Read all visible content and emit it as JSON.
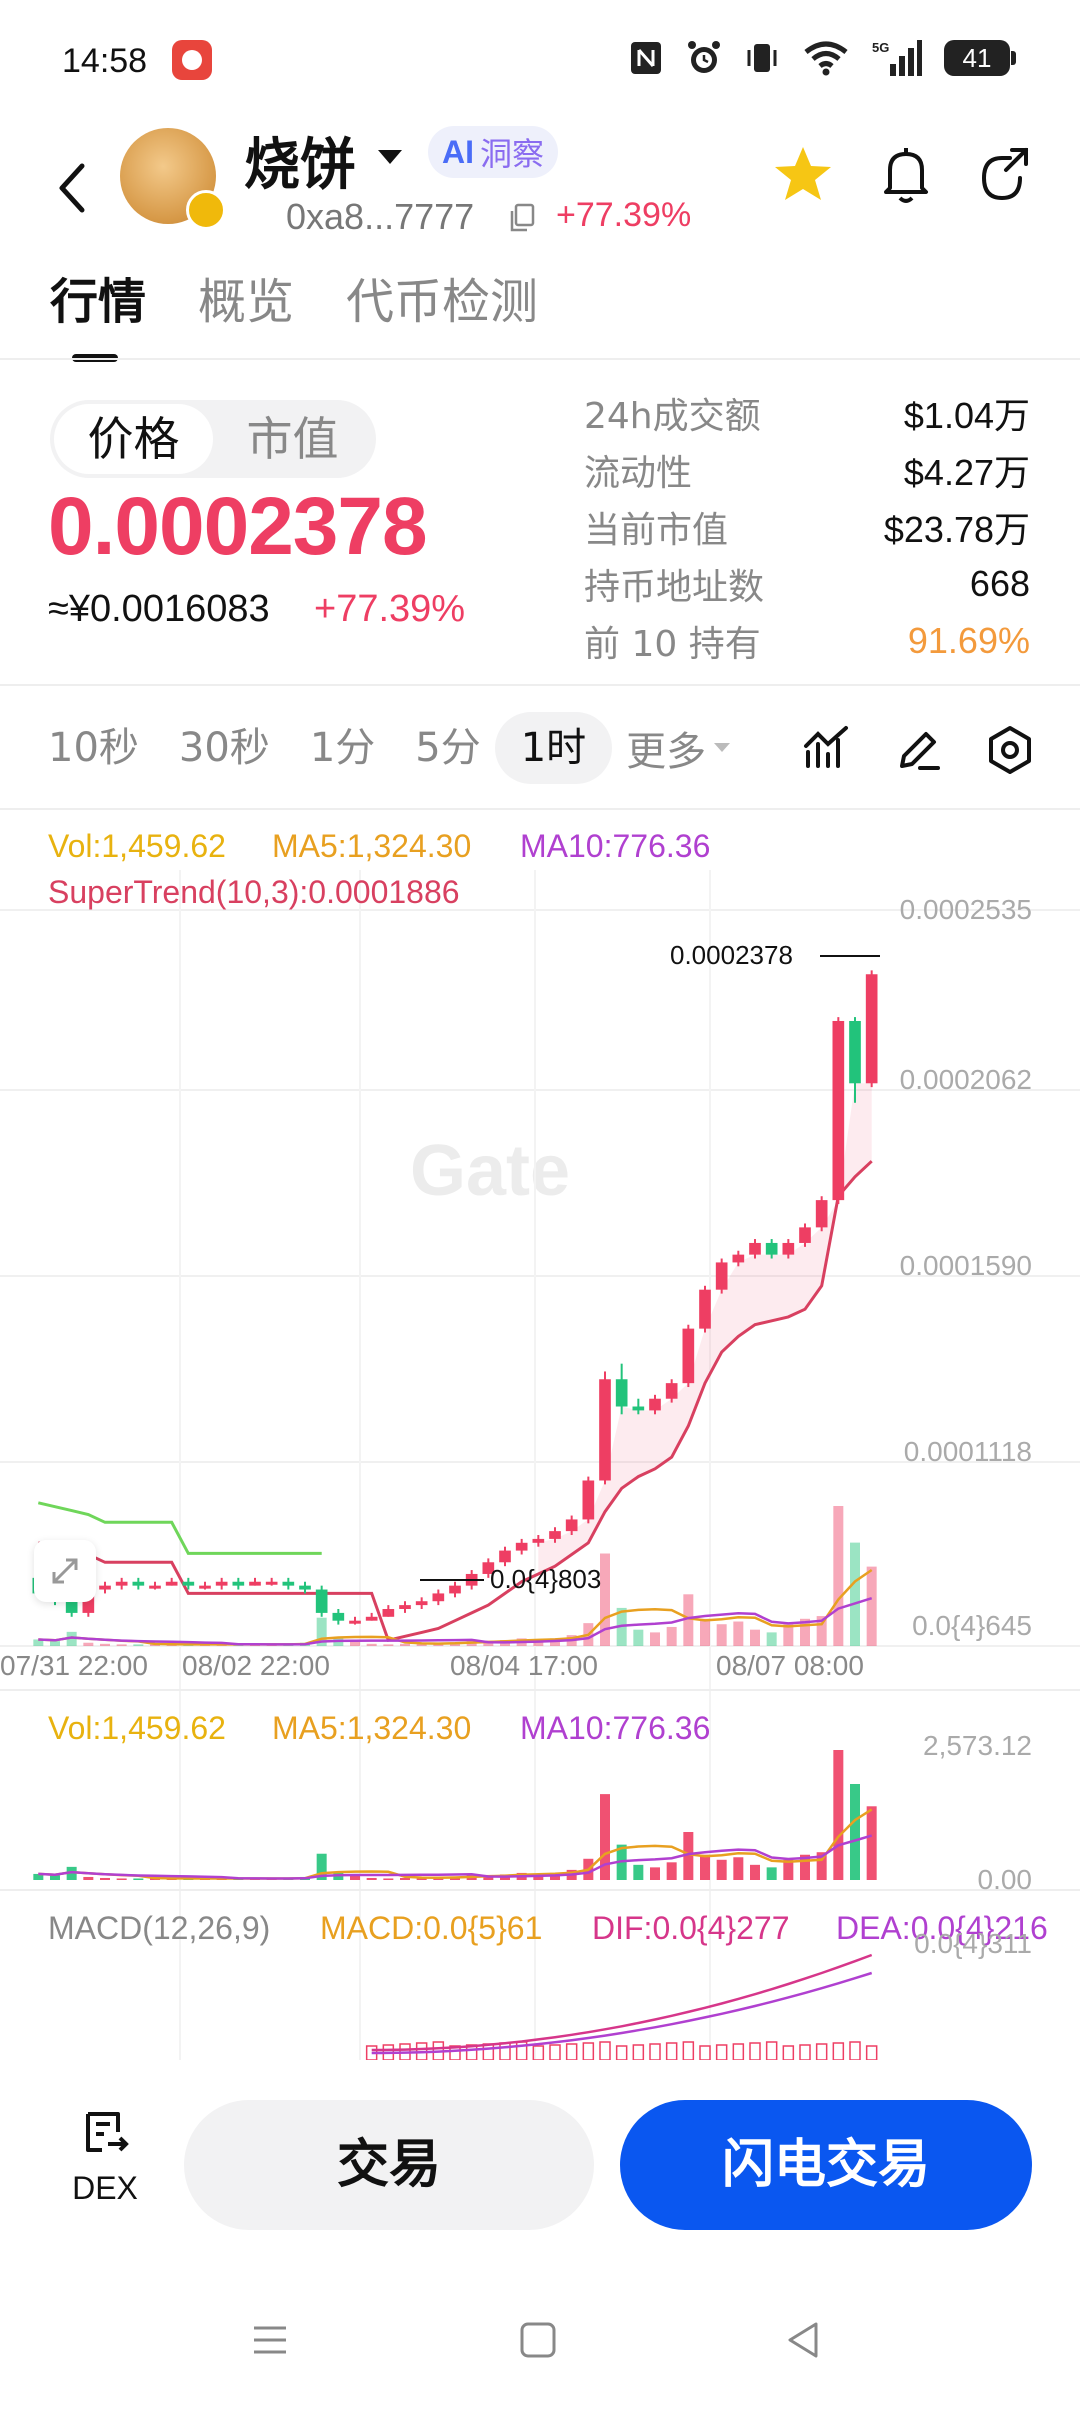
{
  "status_bar": {
    "time": "14:58",
    "battery": "41",
    "icons": [
      "nfc-icon",
      "alarm-icon",
      "vibrate-icon",
      "wifi-icon",
      "5g-signal-icon",
      "battery-icon"
    ]
  },
  "header": {
    "token_name": "烧饼",
    "ai_badge": {
      "prefix": "AI",
      "label": "洞察"
    },
    "address": "0xa8...7777",
    "change": "+77.39%"
  },
  "tabs": [
    {
      "label": "行情",
      "active": true
    },
    {
      "label": "概览",
      "active": false
    },
    {
      "label": "代币检测",
      "active": false
    }
  ],
  "price_panel": {
    "segments": [
      {
        "label": "价格",
        "active": true
      },
      {
        "label": "市值",
        "active": false
      }
    ],
    "price": "0.0002378",
    "price_cny": "≈¥0.0016083",
    "change": "+77.39%",
    "stats": [
      {
        "label": "24h成交额",
        "value": "$1.04万"
      },
      {
        "label": "流动性",
        "value": "$4.27万"
      },
      {
        "label": "当前市值",
        "value": "$23.78万"
      },
      {
        "label": "持币地址数",
        "value": "668"
      },
      {
        "label": "前 10 持有",
        "value": "91.69%",
        "color": "#f39a3c"
      }
    ]
  },
  "intervals": {
    "items": [
      "10秒",
      "30秒",
      "1分",
      "5分",
      "1时"
    ],
    "active": "1时",
    "more": "更多"
  },
  "chart": {
    "legend_main": {
      "vol": "Vol:1,459.62",
      "ma5": "MA5:1,324.30",
      "ma10": "MA10:776.36",
      "supertrend": "SuperTrend(10,3):0.0001886"
    },
    "price_axis": [
      "0.0002535",
      "0.0002062",
      "0.0001590",
      "0.0001118",
      "0.0{4}645"
    ],
    "high_label": "0.0002378",
    "low_label": "0.0{4}803",
    "dates": [
      "07/31 22:00",
      "08/02 22:00",
      "08/04 17:00",
      "08/07 08:00"
    ],
    "watermark": "Gate",
    "legend_vol": {
      "vol": "Vol:1,459.62",
      "ma5": "MA5:1,324.30",
      "ma10": "MA10:776.36"
    },
    "vol_axis": [
      "2,573.12",
      "0.00"
    ],
    "legend_macd": {
      "macd": "MACD(12,26,9)",
      "macd_val": "MACD:0.0{5}61",
      "dif": "DIF:0.0{4}277",
      "dea": "DEA:0.0{4}216"
    },
    "macd_axis": "0.0{4}311"
  },
  "chart_data": {
    "type": "candlestick",
    "ylim": [
      6.45e-05,
      0.0002535
    ],
    "candles": [
      [
        8.2e-05,
        7.8e-05,
        8.3e-05,
        7.7e-05
      ],
      [
        7.8e-05,
        7.6e-05,
        7.9e-05,
        7.5e-05
      ],
      [
        7.6e-05,
        7.3e-05,
        7.7e-05,
        7.2e-05
      ],
      [
        7.3e-05,
        7.9e-05,
        8e-05,
        7.2e-05
      ],
      [
        7.9e-05,
        8e-05,
        8.1e-05,
        7.8e-05
      ],
      [
        8e-05,
        8.1e-05,
        8.2e-05,
        7.9e-05
      ],
      [
        8.1e-05,
        8e-05,
        8.2e-05,
        7.9e-05
      ],
      [
        8e-05,
        8e-05,
        8.1e-05,
        7.9e-05
      ],
      [
        8e-05,
        8.1e-05,
        8.2e-05,
        8e-05
      ],
      [
        8.1e-05,
        8e-05,
        8.2e-05,
        7.9e-05
      ],
      [
        8e-05,
        8e-05,
        8.1e-05,
        7.9e-05
      ],
      [
        8e-05,
        8.1e-05,
        8.2e-05,
        7.9e-05
      ],
      [
        8.1e-05,
        8e-05,
        8.2e-05,
        7.9e-05
      ],
      [
        8e-05,
        8.1e-05,
        8.2e-05,
        8e-05
      ],
      [
        8.1e-05,
        8.1e-05,
        8.2e-05,
        8e-05
      ],
      [
        8.1e-05,
        8e-05,
        8.2e-05,
        7.9e-05
      ],
      [
        8e-05,
        7.9e-05,
        8.1e-05,
        7.8e-05
      ],
      [
        7.9e-05,
        7.3e-05,
        8e-05,
        7.2e-05
      ],
      [
        7.3e-05,
        7.1e-05,
        7.4e-05,
        7e-05
      ],
      [
        7.1e-05,
        7.1e-05,
        7.2e-05,
        7e-05
      ],
      [
        7.1e-05,
        7.2e-05,
        7.3e-05,
        7.1e-05
      ],
      [
        7.2e-05,
        7.4e-05,
        7.5e-05,
        7.2e-05
      ],
      [
        7.4e-05,
        7.5e-05,
        7.6e-05,
        7.3e-05
      ],
      [
        7.5e-05,
        7.6e-05,
        7.7e-05,
        7.4e-05
      ],
      [
        7.6e-05,
        7.8e-05,
        7.9e-05,
        7.5e-05
      ],
      [
        7.8e-05,
        8e-05,
        8.1e-05,
        7.7e-05
      ],
      [
        8e-05,
        8.3e-05,
        8.4e-05,
        7.9e-05
      ],
      [
        8.3e-05,
        8.6e-05,
        8.7e-05,
        8.2e-05
      ],
      [
        8.6e-05,
        8.9e-05,
        9e-05,
        8.5e-05
      ],
      [
        8.9e-05,
        9.1e-05,
        9.2e-05,
        8.8e-05
      ],
      [
        9.1e-05,
        9.2e-05,
        9.3e-05,
        9e-05
      ],
      [
        9.2e-05,
        9.4e-05,
        9.5e-05,
        9.1e-05
      ],
      [
        9.4e-05,
        9.7e-05,
        9.8e-05,
        9.3e-05
      ],
      [
        9.7e-05,
        0.000107,
        0.000108,
        9.6e-05
      ],
      [
        0.000107,
        0.000133,
        0.000135,
        0.000106
      ],
      [
        0.000133,
        0.000126,
        0.000137,
        0.000124
      ],
      [
        0.000126,
        0.000125,
        0.000128,
        0.000124
      ],
      [
        0.000125,
        0.000128,
        0.000129,
        0.000124
      ],
      [
        0.000128,
        0.000132,
        0.000133,
        0.000127
      ],
      [
        0.000132,
        0.000146,
        0.000147,
        0.000131
      ],
      [
        0.000146,
        0.000156,
        0.000157,
        0.000145
      ],
      [
        0.000156,
        0.000163,
        0.000164,
        0.000155
      ],
      [
        0.000163,
        0.000165,
        0.000166,
        0.000162
      ],
      [
        0.000165,
        0.000168,
        0.000169,
        0.000164
      ],
      [
        0.000168,
        0.000165,
        0.000169,
        0.000164
      ],
      [
        0.000165,
        0.000168,
        0.000169,
        0.000164
      ],
      [
        0.000168,
        0.000172,
        0.000173,
        0.000167
      ],
      [
        0.000172,
        0.000179,
        0.00018,
        0.000171
      ],
      [
        0.000179,
        0.000225,
        0.000226,
        0.000178
      ],
      [
        0.000225,
        0.000209,
        0.000226,
        0.000204
      ],
      [
        0.000209,
        0.000237,
        0.000238,
        0.000208
      ]
    ],
    "volumes": [
      120,
      90,
      260,
      60,
      40,
      30,
      30,
      30,
      30,
      30,
      30,
      30,
      30,
      30,
      30,
      30,
      60,
      520,
      140,
      80,
      40,
      30,
      40,
      50,
      60,
      70,
      90,
      100,
      110,
      140,
      120,
      140,
      200,
      420,
      1700,
      700,
      300,
      250,
      350,
      950,
      500,
      400,
      450,
      300,
      250,
      400,
      500,
      550,
      2573,
      1900,
      1459
    ],
    "supertrend": [
      9.1e-05,
      9e-05,
      8.9e-05,
      8.8e-05,
      8.6e-05,
      8.6e-05,
      8.6e-05,
      8.6e-05,
      8.6e-05,
      7.8e-05,
      7.8e-05,
      7.8e-05,
      7.8e-05,
      7.8e-05,
      7.8e-05,
      7.8e-05,
      7.8e-05,
      7.8e-05,
      7.8e-05,
      7.8e-05,
      7.8e-05,
      6.6e-05,
      6.7e-05,
      6.8e-05,
      6.9e-05,
      7.1e-05,
      7.3e-05,
      7.5e-05,
      7.8e-05,
      8.1e-05,
      8.3e-05,
      8.5e-05,
      8.8e-05,
      9.1e-05,
      9.9e-05,
      0.000105,
      0.000108,
      0.00011,
      0.000113,
      0.000121,
      0.000132,
      0.00014,
      0.000144,
      0.000147,
      0.000148,
      0.000149,
      0.000151,
      0.000157,
      0.00018,
      0.000185,
      0.000189
    ]
  }
}
